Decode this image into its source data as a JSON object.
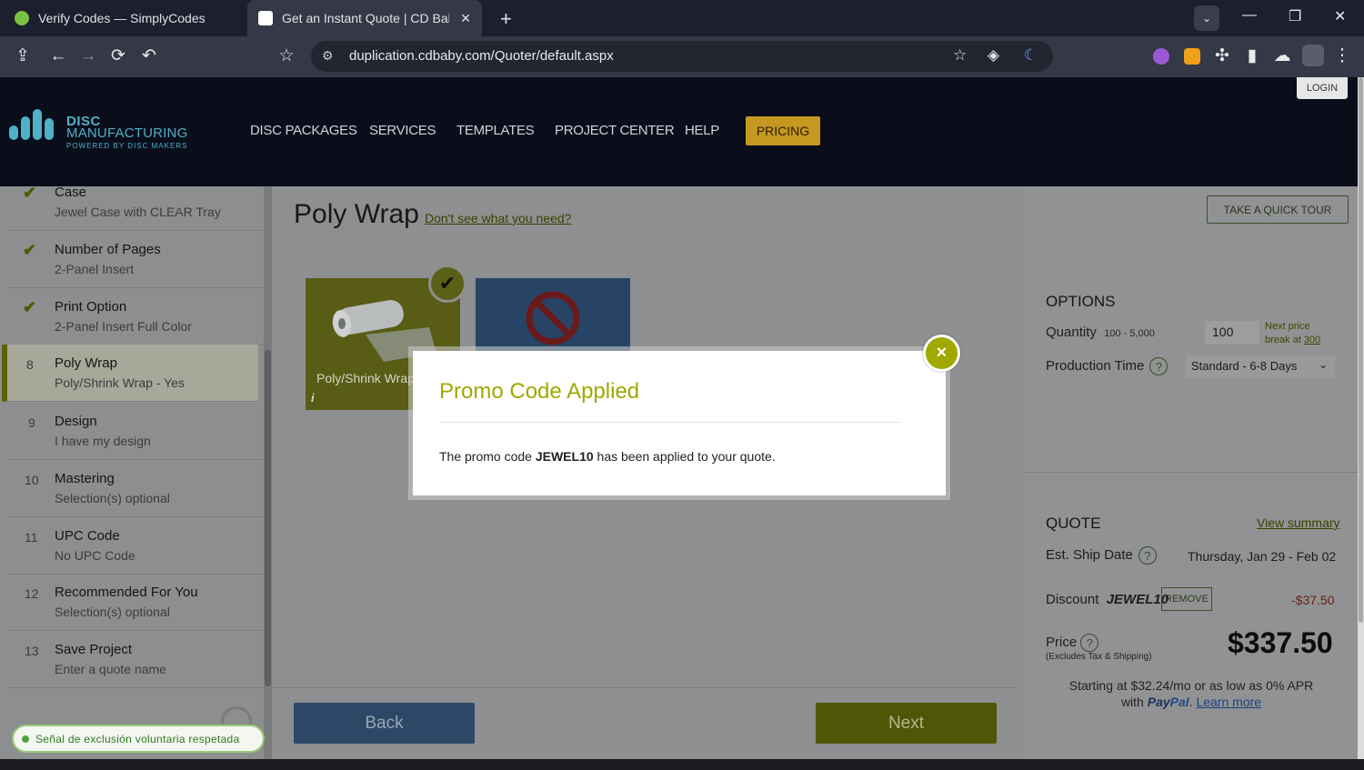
{
  "browser": {
    "tabs": [
      {
        "title": "Verify Codes — SimplyCodes",
        "active": false
      },
      {
        "title": "Get an Instant Quote | CD Baby D",
        "active": true
      }
    ],
    "url": "duplication.cdbaby.com/Quoter/default.aspx"
  },
  "site": {
    "login": "LOGIN",
    "logo": {
      "line1": "DISC",
      "line2": "MANUFACTURING",
      "line3": "POWERED BY DISC MAKERS"
    },
    "nav": [
      "DISC PACKAGES",
      "SERVICES",
      "TEMPLATES",
      "PROJECT CENTER",
      "HELP"
    ],
    "nav_pricing": "PRICING"
  },
  "steps": [
    {
      "num": "",
      "done": true,
      "title": "Case",
      "sub": "Jewel Case with CLEAR Tray"
    },
    {
      "num": "",
      "done": true,
      "title": "Number of Pages",
      "sub": "2-Panel Insert"
    },
    {
      "num": "",
      "done": true,
      "title": "Print Option",
      "sub": "2-Panel Insert Full Color"
    },
    {
      "num": "8",
      "done": false,
      "active": true,
      "title": "Poly Wrap",
      "sub": "Poly/Shrink Wrap - Yes"
    },
    {
      "num": "9",
      "done": false,
      "title": "Design",
      "sub": "I have my design"
    },
    {
      "num": "10",
      "done": false,
      "title": "Mastering",
      "sub": "Selection(s) optional"
    },
    {
      "num": "11",
      "done": false,
      "title": "UPC Code",
      "sub": "No UPC Code"
    },
    {
      "num": "12",
      "done": false,
      "title": "Recommended For You",
      "sub": "Selection(s) optional"
    },
    {
      "num": "13",
      "done": false,
      "title": "Save Project",
      "sub": "Enter a quote name"
    }
  ],
  "main": {
    "title": "Poly Wrap",
    "help_link": "Don't see what you need?",
    "option1_label": "Poly/Shrink Wrap",
    "option1_info": "i",
    "back": "Back",
    "next": "Next"
  },
  "right": {
    "tour": "TAKE A QUICK TOUR",
    "options_heading": "OPTIONS",
    "quantity_label": "Quantity",
    "quantity_range": "100 - 5,000",
    "quantity_value": "100",
    "next_price_1": "Next price",
    "next_price_2": "break at",
    "next_price_value": "300",
    "production_label": "Production Time",
    "production_value": "Standard - 6-8 Days",
    "quote_heading": "QUOTE",
    "view_summary": "View summary",
    "ship_label": "Est. Ship Date",
    "ship_value": "Thursday, Jan 29 - Feb 02",
    "discount_label": "Discount",
    "discount_code": "JEWEL10",
    "remove": "REMOVE",
    "discount_value": "-$37.50",
    "price_label": "Price",
    "price_note": "(Excludes Tax & Shipping)",
    "price_value": "$337.50",
    "finance_line1": "Starting at $32.24/mo or as low as 0% APR",
    "finance_with": "with",
    "finance_pay": "Pay",
    "finance_pal": "Pal",
    "finance_learn": "Learn more"
  },
  "modal": {
    "title": "Promo Code Applied",
    "msg_before": "The promo code ",
    "msg_code": "JEWEL10",
    "msg_after": " has been applied to your quote.",
    "close": "×"
  },
  "toast": "Señal de exclusión voluntaria respetada",
  "colors": {
    "accent": "#a1a800",
    "pricing": "#c59821",
    "header": "#0a0d1a"
  }
}
